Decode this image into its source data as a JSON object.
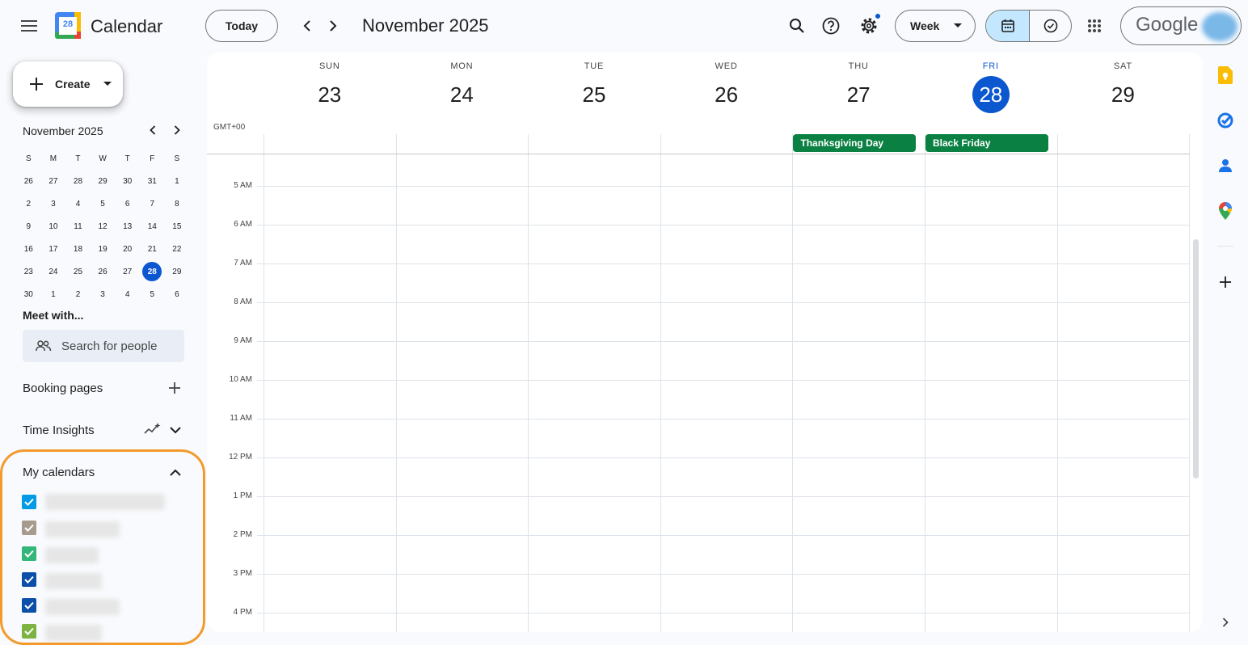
{
  "app": {
    "title": "Calendar",
    "logo_day": "28"
  },
  "header": {
    "today_label": "Today",
    "period_title": "November 2025",
    "view_select": "Week",
    "google_label": "Google"
  },
  "sidebar": {
    "create_label": "Create",
    "mini_calendar": {
      "title": "November 2025",
      "weekdays": [
        "S",
        "M",
        "T",
        "W",
        "T",
        "F",
        "S"
      ],
      "weeks": [
        [
          "26",
          "27",
          "28",
          "29",
          "30",
          "31",
          "1"
        ],
        [
          "2",
          "3",
          "4",
          "5",
          "6",
          "7",
          "8"
        ],
        [
          "9",
          "10",
          "11",
          "12",
          "13",
          "14",
          "15"
        ],
        [
          "16",
          "17",
          "18",
          "19",
          "20",
          "21",
          "22"
        ],
        [
          "23",
          "24",
          "25",
          "26",
          "27",
          "28",
          "29"
        ],
        [
          "30",
          "1",
          "2",
          "3",
          "4",
          "5",
          "6"
        ]
      ],
      "today": "28"
    },
    "meet_with": "Meet with...",
    "search_people_placeholder": "Search for people",
    "booking_pages": "Booking pages",
    "time_insights": "Time Insights",
    "my_calendars": "My calendars",
    "calendar_colors": [
      "#039be5",
      "#a79b8e",
      "#33b679",
      "#0b4fa8",
      "#0b4fa8",
      "#7cb342"
    ]
  },
  "main": {
    "timezone": "GMT+00",
    "days": [
      {
        "dow": "SUN",
        "num": "23"
      },
      {
        "dow": "MON",
        "num": "24"
      },
      {
        "dow": "TUE",
        "num": "25"
      },
      {
        "dow": "WED",
        "num": "26"
      },
      {
        "dow": "THU",
        "num": "27"
      },
      {
        "dow": "FRI",
        "num": "28"
      },
      {
        "dow": "SAT",
        "num": "29"
      }
    ],
    "current_day_index": 5,
    "allday_events": [
      {
        "title": "Thanksgiving Day",
        "day_index": 4,
        "color": "#0b8043"
      },
      {
        "title": "Black Friday",
        "day_index": 5,
        "color": "#0b8043"
      }
    ],
    "hours": [
      "5 AM",
      "6 AM",
      "7 AM",
      "8 AM",
      "9 AM",
      "10 AM",
      "11 AM",
      "12 PM",
      "1 PM",
      "2 PM",
      "3 PM",
      "4 PM"
    ]
  },
  "colors": {
    "accent": "#0b57d0",
    "highlight": "#f39a2b"
  }
}
